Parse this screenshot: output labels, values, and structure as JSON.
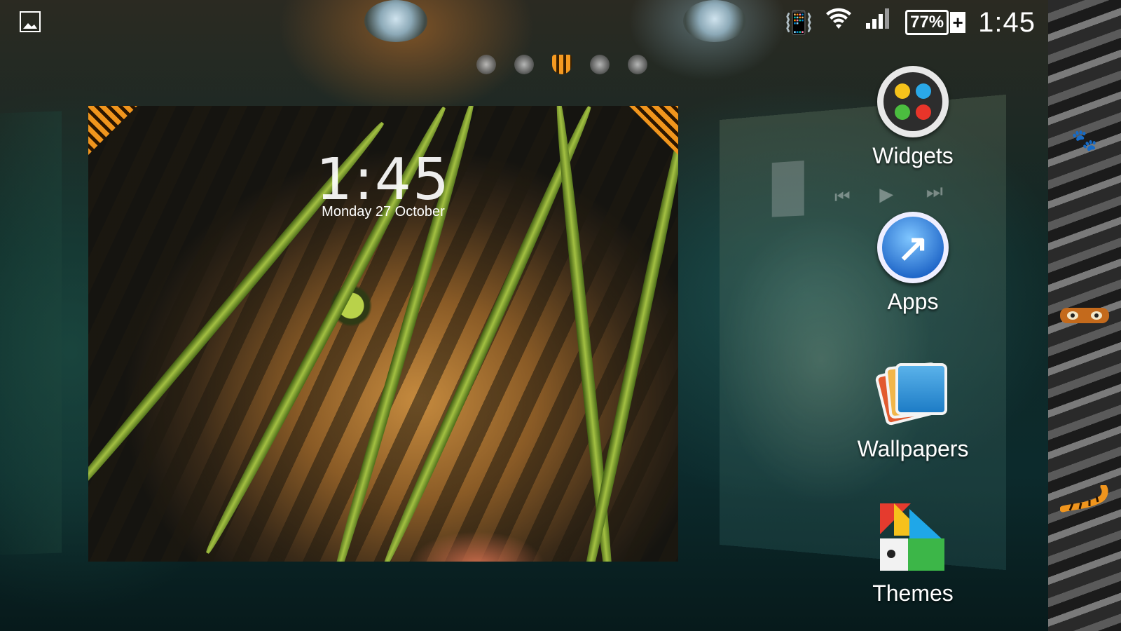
{
  "status_bar": {
    "left_icon": "image-icon",
    "icons": [
      "vibrate-icon",
      "wifi-icon",
      "signal-icon"
    ],
    "battery_percent": "77%",
    "battery_charging": "+",
    "time": "1:45"
  },
  "pager": {
    "page_count": 5,
    "active_index": 2
  },
  "lockscreen": {
    "time": "1:45",
    "date": "Monday 27 October"
  },
  "menu": {
    "items": [
      {
        "label": "Widgets",
        "icon": "widgets-icon"
      },
      {
        "label": "Apps",
        "icon": "apps-icon"
      },
      {
        "label": "Wallpapers",
        "icon": "wallpapers-icon"
      },
      {
        "label": "Themes",
        "icon": "themes-icon"
      }
    ]
  },
  "side_strip": {
    "icons": [
      "paw-icon",
      "tiger-eyes-icon",
      "tiger-tail-icon"
    ]
  },
  "colors": {
    "accent_orange": "#f0951d",
    "panel_teal": "#0c2a2c"
  }
}
